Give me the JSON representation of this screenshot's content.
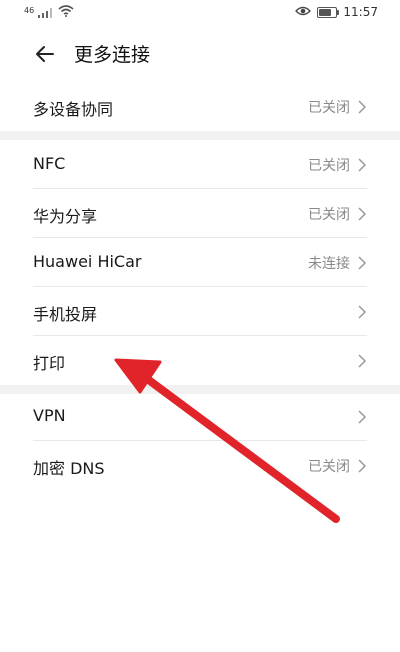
{
  "status_bar": {
    "signal_tag": "46",
    "time": "11:57"
  },
  "header": {
    "title": "更多连接"
  },
  "section1": [
    {
      "label": "多设备协同",
      "value": "已关闭"
    }
  ],
  "section2": [
    {
      "label": "NFC",
      "value": "已关闭"
    },
    {
      "label": "华为分享",
      "value": "已关闭"
    },
    {
      "label": "Huawei HiCar",
      "value": "未连接"
    },
    {
      "label": "手机投屏",
      "value": ""
    },
    {
      "label": "打印",
      "value": ""
    }
  ],
  "section3": [
    {
      "label": "VPN",
      "value": ""
    },
    {
      "label": "加密 DNS",
      "value": "已关闭"
    }
  ],
  "colors": {
    "annotation_arrow": "#e0242a",
    "section_gap": "#f1f1f1"
  }
}
